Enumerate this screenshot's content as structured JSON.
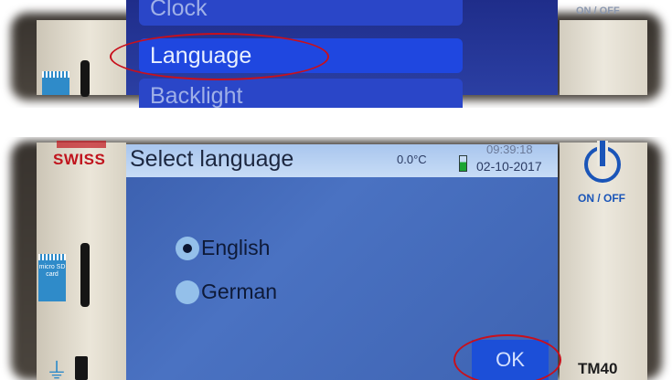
{
  "top_panel": {
    "menu_items": [
      {
        "label": "Clock",
        "state": "partially-visible"
      },
      {
        "label": "Language",
        "state": "highlighted"
      },
      {
        "label": "Backlight",
        "state": "partially-visible"
      }
    ],
    "power_label": "ON / OFF"
  },
  "bottom_panel": {
    "brand": "SWISS",
    "title": "Select language",
    "temperature": "0.0°C",
    "time": "09:39:18",
    "date": "02-10-2017",
    "options": [
      {
        "label": "English",
        "selected": true
      },
      {
        "label": "German",
        "selected": false
      }
    ],
    "ok_label": "OK",
    "power_label": "ON / OFF",
    "sd_label": "micro SD card",
    "model": "TM40",
    "usb_icon": "usb-icon"
  },
  "colors": {
    "screen_blue": "#4a72c2",
    "menu_blue": "#1f47e0",
    "highlight_red": "#c8101c",
    "brand_red": "#c0141d",
    "power_blue": "#1a55b8"
  }
}
